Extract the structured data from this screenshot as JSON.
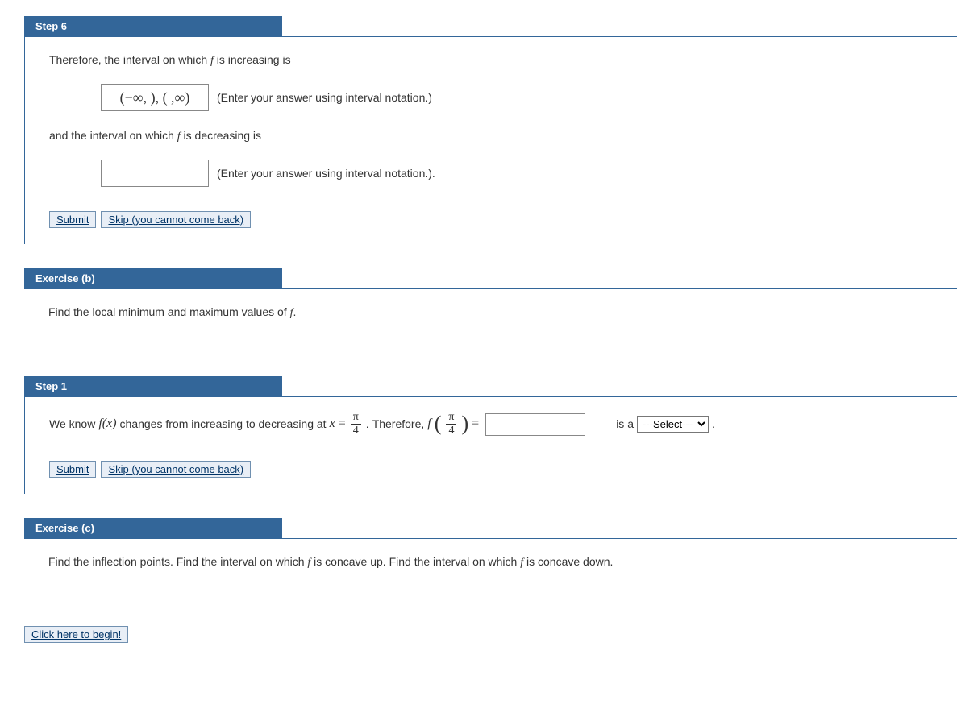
{
  "step6": {
    "label": "Step 6",
    "text1_a": "Therefore, the interval on which ",
    "text1_b": " is increasing is",
    "box1_value": "(−∞, ), ( ,∞)",
    "hint1": "(Enter your answer using interval notation.)",
    "text2_a": "and the interval on which ",
    "text2_b": " is decreasing is",
    "box2_value": "",
    "hint2": "(Enter your answer using interval notation.).",
    "submit": "Submit",
    "skip": "Skip (you cannot come back)"
  },
  "exB": {
    "label": "Exercise (b)",
    "text_a": "Find the local minimum and maximum values of ",
    "text_b": "."
  },
  "step1": {
    "label": "Step 1",
    "t1": "We know  ",
    "fx": "f(x)",
    "t2": "  changes from increasing to decreasing at  ",
    "xeq": "x",
    "eq": " = ",
    "frac_num": "π",
    "frac_den": "4",
    "period": ".",
    "t3": "   Therefore, ",
    "fof": "f",
    "eq2": " = ",
    "box_value": "",
    "t4": " is a ",
    "select": "---Select---",
    "t5": " .",
    "submit": "Submit",
    "skip": "Skip (you cannot come back)"
  },
  "exC": {
    "label": "Exercise (c)",
    "text_a": "Find the inflection points. Find the interval on which ",
    "text_b": " is concave up. Find the interval on which ",
    "text_c": " is concave down."
  },
  "begin": "Click here to begin!",
  "fvar": "f"
}
